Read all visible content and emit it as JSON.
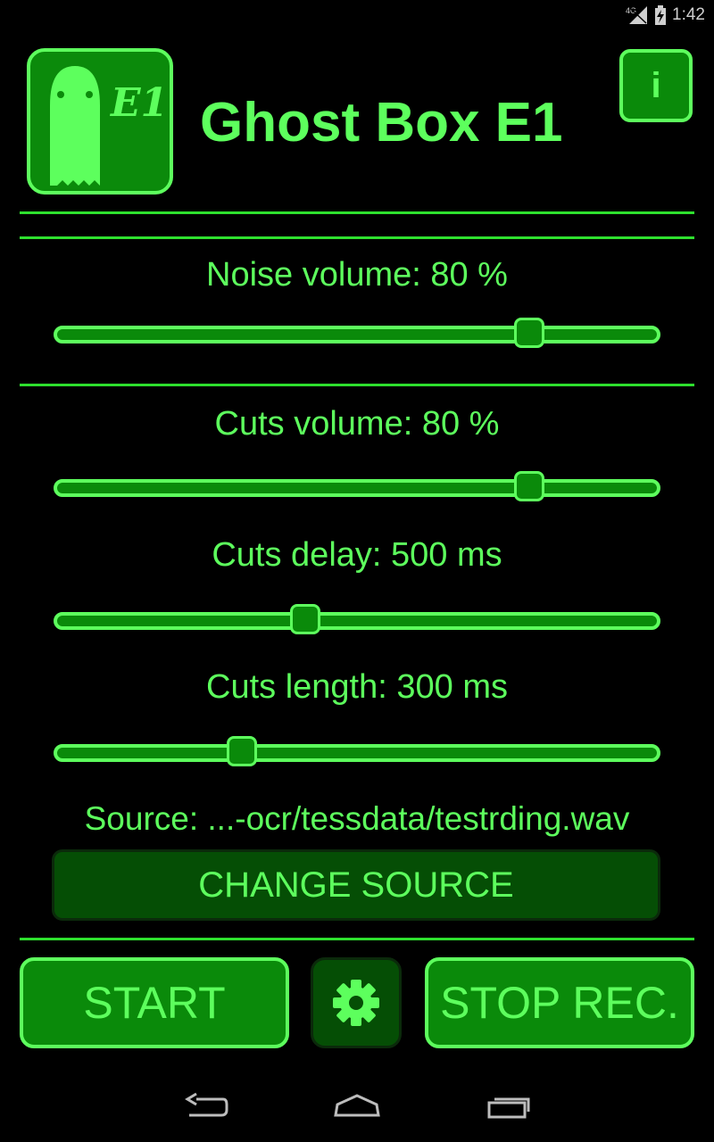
{
  "status_bar": {
    "time": "1:42",
    "network": "4G"
  },
  "header": {
    "title": "Ghost Box E1",
    "logo_text": "E1",
    "info_label": "i"
  },
  "sliders": [
    {
      "label": "Noise volume: 80 %",
      "value_fraction": 0.8
    },
    {
      "label": "Cuts volume: 80 %",
      "value_fraction": 0.8
    },
    {
      "label": "Cuts delay: 500 ms",
      "value_fraction": 0.41
    },
    {
      "label": "Cuts length: 300 ms",
      "value_fraction": 0.3
    }
  ],
  "source": {
    "text": "Source: ...-ocr/tessdata/testrding.wav",
    "change_label": "CHANGE SOURCE"
  },
  "controls": {
    "start_label": "START",
    "stop_label": "STOP REC.",
    "settings_icon": "gear-icon"
  },
  "icons": {
    "back": "back-icon",
    "home": "home-icon",
    "recents": "recents-icon"
  },
  "colors": {
    "accent": "#5dff5d",
    "button_fill": "#0a8a0a",
    "dark_button_fill": "#054e05",
    "background": "#000000"
  }
}
